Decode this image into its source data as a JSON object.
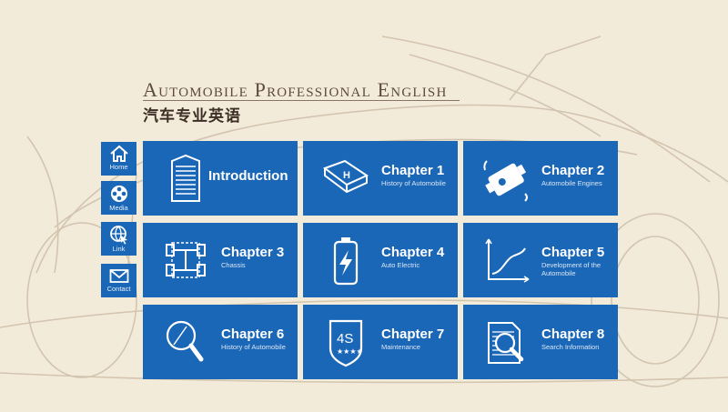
{
  "header": {
    "title": "Automobile Professional English",
    "subtitle": "汽车专业英语"
  },
  "sidebar": [
    {
      "label": "Home",
      "icon": "home-icon"
    },
    {
      "label": "Media",
      "icon": "film-reel-icon"
    },
    {
      "label": "Link",
      "icon": "globe-link-icon"
    },
    {
      "label": "Contact",
      "icon": "envelope-icon"
    }
  ],
  "tiles": [
    {
      "title": "Introduction",
      "subtitle": "",
      "icon": "document-icon"
    },
    {
      "title": "Chapter 1",
      "subtitle": "History of Automobile",
      "icon": "book-icon"
    },
    {
      "title": "Chapter 2",
      "subtitle": "Automobile Engines",
      "icon": "engine-icon"
    },
    {
      "title": "Chapter 3",
      "subtitle": "Chassis",
      "icon": "chassis-icon"
    },
    {
      "title": "Chapter 4",
      "subtitle": "Auto Electric",
      "icon": "battery-icon"
    },
    {
      "title": "Chapter 5",
      "subtitle": "Development of the Automobile",
      "icon": "chart-icon"
    },
    {
      "title": "Chapter 6",
      "subtitle": "History of Automobile",
      "icon": "magnifier-icon"
    },
    {
      "title": "Chapter 7",
      "subtitle": "Maintenance",
      "icon": "shield-4s-icon"
    },
    {
      "title": "Chapter 8",
      "subtitle": "Search Information",
      "icon": "search-document-icon"
    }
  ],
  "badge_4s": "4S",
  "colors": {
    "tile": "#1b67b7",
    "background": "#f3ebda",
    "title": "#5e4b3c"
  }
}
